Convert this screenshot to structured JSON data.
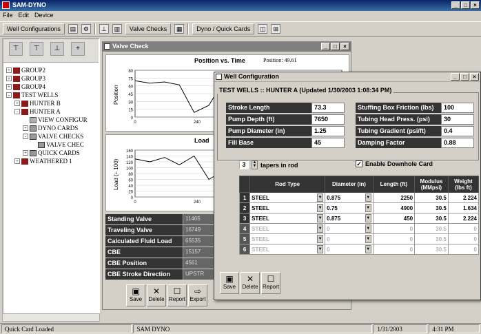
{
  "app": {
    "title": "SAM-DYNO"
  },
  "menu": [
    "File",
    "Edit",
    "Device"
  ],
  "toolbar": {
    "well_configurations": "Well Configurations",
    "valve_checks": "Valve Checks",
    "dyno_quick_cards": "Dyno / Quick Cards"
  },
  "tree": [
    {
      "label": "GROUP2",
      "level": 0,
      "expander": "+",
      "icon": "red"
    },
    {
      "label": "GROUP3",
      "level": 0,
      "expander": "+",
      "icon": "red"
    },
    {
      "label": "GROUP4",
      "level": 0,
      "expander": "+",
      "icon": "red"
    },
    {
      "label": "TEST WELLS",
      "level": 0,
      "expander": "-",
      "icon": "red"
    },
    {
      "label": "HUNTER B",
      "level": 1,
      "expander": "+",
      "icon": "red"
    },
    {
      "label": "HUNTER A",
      "level": 1,
      "expander": "-",
      "icon": "red"
    },
    {
      "label": "VIEW CONFIGUR",
      "level": 2,
      "expander": "",
      "icon": "gray"
    },
    {
      "label": "DYNO CARDS",
      "level": 2,
      "expander": "+",
      "icon": "grid"
    },
    {
      "label": "VALVE CHECKS",
      "level": 2,
      "expander": "-",
      "icon": "grid"
    },
    {
      "label": "VALVE CHEC",
      "level": 3,
      "expander": "",
      "icon": "grid"
    },
    {
      "label": "QUICK CARDS",
      "level": 2,
      "expander": "+",
      "icon": "grid"
    },
    {
      "label": "WEATHERED 1",
      "level": 1,
      "expander": "+",
      "icon": "red"
    }
  ],
  "valve_window": {
    "title": "Valve Check",
    "chart1_title": "Position vs. Time",
    "chart1_ylabel": "Position",
    "chart1_readout": "Position: 49.61",
    "chart2_title": "Load",
    "chart2_ylabel": "Load (÷ 100)",
    "rows": [
      {
        "label": "Standing Valve",
        "value": "11465"
      },
      {
        "label": "Traveling Valve",
        "value": "16749"
      },
      {
        "label": "Calculated Fluid Load",
        "value": "65535"
      },
      {
        "label": "CBE",
        "value": "15157"
      },
      {
        "label": "CBE Position",
        "value": "4561"
      },
      {
        "label": "CBE Stroke Direction",
        "value": "UPSTR"
      }
    ],
    "buttons": [
      "Save",
      "Delete",
      "Report",
      "Export"
    ]
  },
  "chart_data": [
    {
      "type": "line",
      "title": "Position vs. Time",
      "ylabel": "Position",
      "yticks": [
        "80",
        "75",
        "60",
        "45",
        "30",
        "15",
        "0"
      ],
      "xticks": [
        "0",
        "240"
      ],
      "series": [
        {
          "values": [
            62,
            58,
            60,
            55,
            8,
            20,
            62,
            58,
            60,
            62,
            61,
            60,
            62,
            61,
            63
          ]
        }
      ]
    },
    {
      "type": "line",
      "title": "Load",
      "ylabel": "Load (÷ 100)",
      "yticks": [
        "160",
        "140",
        "120",
        "100",
        "80",
        "60",
        "40",
        "20",
        "0"
      ],
      "xticks": [
        "0",
        "240"
      ],
      "series": [
        {
          "values": [
            130,
            120,
            135,
            110,
            140,
            60,
            90,
            130,
            132,
            134,
            131,
            133,
            135,
            134,
            136
          ]
        }
      ]
    }
  ],
  "well_window": {
    "title": "Well Configuration",
    "header": "TEST WELLS :: HUNTER A  (Updated 1/30/2003 1:08:34 PM)",
    "left_params": [
      {
        "label": "Stroke Length",
        "value": "73.3"
      },
      {
        "label": "Pump Depth (ft)",
        "value": "7650"
      },
      {
        "label": "Pump Diameter (in)",
        "value": "1.25"
      },
      {
        "label": "Fill Base",
        "value": "45"
      }
    ],
    "right_params": [
      {
        "label": "Stuffing Box Friction (lbs)",
        "value": "100"
      },
      {
        "label": "Tubing Head Press. (psi)",
        "value": "30"
      },
      {
        "label": "Tubing Gradient (psi/ft)",
        "value": "0.4"
      },
      {
        "label": "Damping Factor",
        "value": "0.88"
      }
    ],
    "tapers_value": "3",
    "tapers_label": "tapers in rod",
    "downhole_label": "Enable Downhole Card",
    "columns": [
      "Rod Type",
      "Diameter (in)",
      "Length (ft)",
      "Modulus (MMpsi)",
      "Weight (lbs ft)"
    ],
    "rods": [
      {
        "num": "1",
        "type": "STEEL",
        "diameter": "0.875",
        "length": "2250",
        "modulus": "30.5",
        "weight": "2.224",
        "enabled": true
      },
      {
        "num": "2",
        "type": "STEEL",
        "diameter": "0.75",
        "length": "4900",
        "modulus": "30.5",
        "weight": "1.634",
        "enabled": true
      },
      {
        "num": "3",
        "type": "STEEL",
        "diameter": "0.875",
        "length": "450",
        "modulus": "30.5",
        "weight": "2.224",
        "enabled": true
      },
      {
        "num": "4",
        "type": "STEEL",
        "diameter": "0",
        "length": "0",
        "modulus": "30.5",
        "weight": "0",
        "enabled": false
      },
      {
        "num": "5",
        "type": "STEEL",
        "diameter": "0",
        "length": "0",
        "modulus": "30.5",
        "weight": "0",
        "enabled": false
      },
      {
        "num": "6",
        "type": "STEEL",
        "diameter": "0",
        "length": "0",
        "modulus": "30.5",
        "weight": "0",
        "enabled": false
      }
    ],
    "buttons": [
      "Save",
      "Delete",
      "Report"
    ]
  },
  "status": {
    "message": "Quick Card Loaded",
    "app": "SAM DYNO",
    "date": "1/31/2003",
    "time": "4:31 PM"
  }
}
